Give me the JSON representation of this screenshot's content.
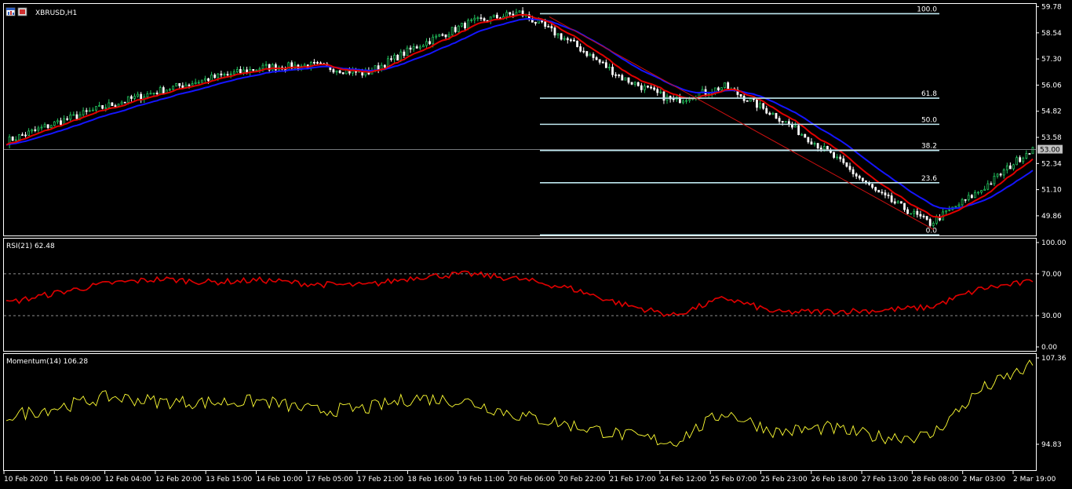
{
  "window": {
    "symbol_title": "XBRUSD,H1",
    "icon": "window-menu-icon"
  },
  "colors": {
    "background": "#000000",
    "grid_frame": "#ffffff",
    "bull_candle": "#22c55e",
    "bear_candle": "#ffffff",
    "ma_fast": "#e00000",
    "ma_slow": "#1515ff",
    "fibo": "#bfe8f0",
    "channel": "#cc1010",
    "rsi_line": "#e00000",
    "momentum_line": "#ffff33",
    "price_tag_bg": "#c0c0c0"
  },
  "price_pane": {
    "axis_labels": [
      "59.78",
      "58.54",
      "57.30",
      "56.06",
      "54.82",
      "53.58",
      "52.34",
      "51.10",
      "49.86"
    ],
    "current_price": "53.00",
    "fibo_levels": [
      "100.0",
      "61.8",
      "50.0",
      "38.2",
      "23.6",
      "0.0"
    ]
  },
  "rsi_pane": {
    "title": "RSI(21) 62.48",
    "axis_labels": [
      "100.00",
      "70.00",
      "30.00",
      "0.00"
    ]
  },
  "momentum_pane": {
    "title": "Momentum(14) 106.28",
    "axis_labels": [
      "107.36",
      "94.83"
    ]
  },
  "time_axis": {
    "labels": [
      "10 Feb 2020",
      "11 Feb 09:00",
      "12 Feb 04:00",
      "12 Feb 20:00",
      "13 Feb 15:00",
      "14 Feb 10:00",
      "17 Feb 05:00",
      "17 Feb 21:00",
      "18 Feb 16:00",
      "19 Feb 11:00",
      "20 Feb 06:00",
      "20 Feb 22:00",
      "21 Feb 17:00",
      "24 Feb 12:00",
      "25 Feb 07:00",
      "25 Feb 23:00",
      "26 Feb 18:00",
      "27 Feb 13:00",
      "28 Feb 08:00",
      "2 Mar 03:00",
      "2 Mar 19:00"
    ]
  },
  "chart_data": {
    "type": "line",
    "x": [
      "10 Feb 2020",
      "11 Feb 09:00",
      "12 Feb 04:00",
      "12 Feb 20:00",
      "13 Feb 15:00",
      "14 Feb 10:00",
      "17 Feb 05:00",
      "17 Feb 21:00",
      "18 Feb 16:00",
      "19 Feb 11:00",
      "20 Feb 06:00",
      "20 Feb 22:00",
      "21 Feb 17:00",
      "24 Feb 12:00",
      "25 Feb 07:00",
      "25 Feb 23:00",
      "26 Feb 18:00",
      "27 Feb 13:00",
      "28 Feb 08:00",
      "2 Mar 03:00",
      "2 Mar 19:00"
    ],
    "series": [
      {
        "name": "XBRUSD,H1",
        "values": [
          53.4,
          54.3,
          55.1,
          55.8,
          56.4,
          56.9,
          57.0,
          56.6,
          57.9,
          59.0,
          59.5,
          58.1,
          56.4,
          55.3,
          56.0,
          54.6,
          52.9,
          50.9,
          49.5,
          51.1,
          53.1
        ]
      },
      {
        "name": "RSI(21)",
        "values": [
          42,
          52,
          61,
          65,
          62,
          64,
          60,
          59,
          67,
          70,
          65,
          56,
          41,
          30,
          47,
          33,
          34,
          35,
          38,
          56,
          62.48
        ]
      },
      {
        "name": "Momentum(14)",
        "values": [
          98.9,
          100.2,
          101.7,
          101.0,
          100.9,
          101.1,
          99.7,
          100.0,
          101.6,
          101.0,
          99.0,
          97.6,
          96.2,
          95.1,
          99.5,
          96.6,
          97.2,
          95.9,
          96.0,
          102.8,
          106.28
        ]
      }
    ],
    "price_ylim": [
      49.0,
      59.8
    ],
    "rsi_ylim": [
      0,
      100
    ],
    "momentum_ylim": [
      94.83,
      107.36
    ],
    "fibo": {
      "high": 59.45,
      "low": 48.95,
      "levels": [
        100.0,
        61.8,
        50.0,
        38.2,
        23.6,
        0.0
      ]
    },
    "rsi_levels": [
      70,
      30
    ],
    "current_price": 53.0,
    "grid": false
  }
}
